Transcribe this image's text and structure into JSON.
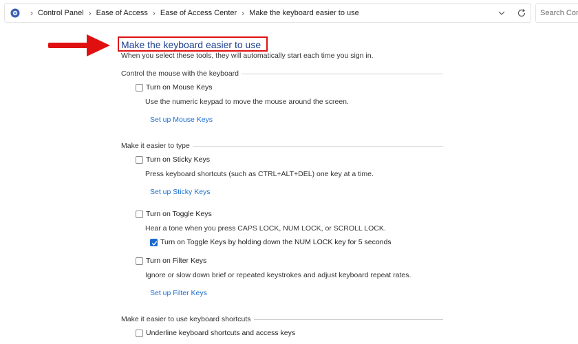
{
  "address_bar": {
    "breadcrumbs": [
      "Control Panel",
      "Ease of Access",
      "Ease of Access Center",
      "Make the keyboard easier to use"
    ],
    "search_placeholder": "Search Contr"
  },
  "page": {
    "title": "Make the keyboard easier to use",
    "subtitle": "When you select these tools, they will automatically start each time you sign in."
  },
  "sections": {
    "mouse": {
      "heading": "Control the mouse with the keyboard",
      "mouse_keys": {
        "label": "Turn on Mouse Keys",
        "checked": false,
        "desc": "Use the numeric keypad to move the mouse around the screen.",
        "link": "Set up Mouse Keys"
      }
    },
    "typing": {
      "heading": "Make it easier to type",
      "sticky_keys": {
        "label": "Turn on Sticky Keys",
        "checked": false,
        "desc": "Press keyboard shortcuts (such as CTRL+ALT+DEL) one key at a time.",
        "link": "Set up Sticky Keys"
      },
      "toggle_keys": {
        "label": "Turn on Toggle Keys",
        "checked": false,
        "desc": "Hear a tone when you press CAPS LOCK, NUM LOCK, or SCROLL LOCK.",
        "sub_option": {
          "label": "Turn on Toggle Keys by holding down the NUM LOCK key for 5 seconds",
          "checked": true
        }
      },
      "filter_keys": {
        "label": "Turn on Filter Keys",
        "checked": false,
        "desc": "Ignore or slow down brief or repeated keystrokes and adjust keyboard repeat rates.",
        "link": "Set up Filter Keys"
      }
    },
    "shortcuts": {
      "heading": "Make it easier to use keyboard shortcuts",
      "underline": {
        "label": "Underline keyboard shortcuts and access keys",
        "checked": false
      }
    }
  },
  "colors": {
    "annotation_red": "#e01010",
    "link_blue": "#1a6fcf",
    "title_blue": "#1b3f8f",
    "check_blue": "#1a6ad1"
  }
}
